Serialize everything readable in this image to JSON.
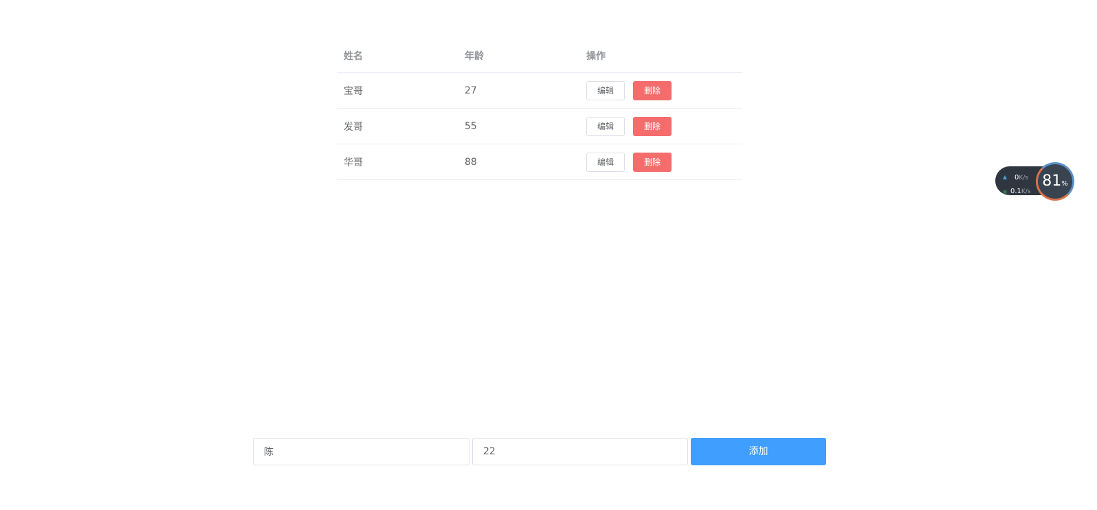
{
  "table": {
    "headers": {
      "name": "姓名",
      "age": "年龄",
      "actions": "操作"
    },
    "rows": [
      {
        "name": "宝哥",
        "age": "27",
        "edit_label": "编辑",
        "delete_label": "删除"
      },
      {
        "name": "发哥",
        "age": "55",
        "edit_label": "编辑",
        "delete_label": "删除"
      },
      {
        "name": "华哥",
        "age": "88",
        "edit_label": "编辑",
        "delete_label": "删除"
      }
    ]
  },
  "form": {
    "name_value": "陈",
    "age_value": "22",
    "add_label": "添加"
  },
  "net_widget": {
    "upload_value": "0",
    "upload_unit": "K/s",
    "download_value": "0.1",
    "download_unit": "K/s",
    "cpu_value": "81",
    "cpu_unit": "%",
    "upload_icon": "arrow-up-icon",
    "download_icon": "arrow-down-icon"
  },
  "colors": {
    "primary": "#409eff",
    "danger": "#f56c6c",
    "header_text": "#909399",
    "body_text": "#606266"
  }
}
